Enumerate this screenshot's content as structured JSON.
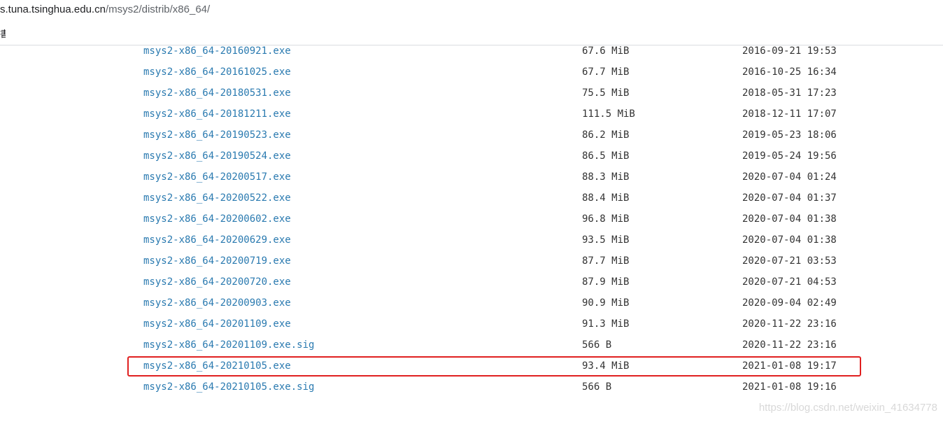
{
  "address_bar": {
    "host": "s.tuna.tsinghua.edu.cn",
    "path": "/msys2/distrib/x86_64/"
  },
  "bookmarks_bar": {
    "fragment": "書"
  },
  "files": [
    {
      "name": "msys2-x86_64-20160921.exe",
      "size": "67.6 MiB",
      "date": "2016-09-21 19:53"
    },
    {
      "name": "msys2-x86_64-20161025.exe",
      "size": "67.7 MiB",
      "date": "2016-10-25 16:34"
    },
    {
      "name": "msys2-x86_64-20180531.exe",
      "size": "75.5 MiB",
      "date": "2018-05-31 17:23"
    },
    {
      "name": "msys2-x86_64-20181211.exe",
      "size": "111.5 MiB",
      "date": "2018-12-11 17:07"
    },
    {
      "name": "msys2-x86_64-20190523.exe",
      "size": "86.2 MiB",
      "date": "2019-05-23 18:06"
    },
    {
      "name": "msys2-x86_64-20190524.exe",
      "size": "86.5 MiB",
      "date": "2019-05-24 19:56"
    },
    {
      "name": "msys2-x86_64-20200517.exe",
      "size": "88.3 MiB",
      "date": "2020-07-04 01:24"
    },
    {
      "name": "msys2-x86_64-20200522.exe",
      "size": "88.4 MiB",
      "date": "2020-07-04 01:37"
    },
    {
      "name": "msys2-x86_64-20200602.exe",
      "size": "96.8 MiB",
      "date": "2020-07-04 01:38"
    },
    {
      "name": "msys2-x86_64-20200629.exe",
      "size": "93.5 MiB",
      "date": "2020-07-04 01:38"
    },
    {
      "name": "msys2-x86_64-20200719.exe",
      "size": "87.7 MiB",
      "date": "2020-07-21 03:53"
    },
    {
      "name": "msys2-x86_64-20200720.exe",
      "size": "87.9 MiB",
      "date": "2020-07-21 04:53"
    },
    {
      "name": "msys2-x86_64-20200903.exe",
      "size": "90.9 MiB",
      "date": "2020-09-04 02:49"
    },
    {
      "name": "msys2-x86_64-20201109.exe",
      "size": "91.3 MiB",
      "date": "2020-11-22 23:16"
    },
    {
      "name": "msys2-x86_64-20201109.exe.sig",
      "size": "566 B",
      "date": "2020-11-22 23:16"
    },
    {
      "name": "msys2-x86_64-20210105.exe",
      "size": "93.4 MiB",
      "date": "2021-01-08 19:17"
    },
    {
      "name": "msys2-x86_64-20210105.exe.sig",
      "size": "566 B",
      "date": "2021-01-08 19:16"
    }
  ],
  "highlight": {
    "row_index": 15,
    "color": "#e02020"
  },
  "colors": {
    "link": "#2a7ab0",
    "text": "#333333"
  },
  "watermark": "https://blog.csdn.net/weixin_41634778"
}
